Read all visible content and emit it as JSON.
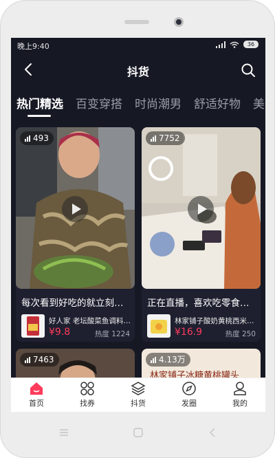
{
  "status_bar": {
    "time": "晚上9:40",
    "battery": "36"
  },
  "header": {
    "title": "抖货"
  },
  "tabs": [
    {
      "label": "热门精选",
      "active": true
    },
    {
      "label": "百变穿搭",
      "active": false
    },
    {
      "label": "时尚潮男",
      "active": false
    },
    {
      "label": "舒适好物",
      "active": false
    },
    {
      "label": "美",
      "active": false
    }
  ],
  "cards": [
    {
      "views": "493",
      "title": "每次看到好吃的就立刻…",
      "product_name": "好人家 老坛酸菜鱼调料…",
      "price": "¥9.8",
      "heat": "热度 1224"
    },
    {
      "views": "7752",
      "title": "正在直播，喜欢吃零食…",
      "product_name": "林家铺子酸奶黄桃西米…",
      "price": "¥16.9",
      "heat": "热度 250"
    },
    {
      "views": "7463"
    },
    {
      "views": "4.13万",
      "overlay_text": "林家铺子冰糖黄桃罐头"
    }
  ],
  "tabbar": [
    {
      "label": "首页",
      "icon": "home-icon",
      "active": true
    },
    {
      "label": "找券",
      "icon": "grid-icon",
      "active": false
    },
    {
      "label": "抖货",
      "icon": "layers-icon",
      "active": false
    },
    {
      "label": "发圈",
      "icon": "compass-icon",
      "active": false
    },
    {
      "label": "我的",
      "icon": "person-icon",
      "active": false
    }
  ],
  "colors": {
    "accent": "#ff3b5c",
    "background": "#161824",
    "card": "#1e2030"
  }
}
